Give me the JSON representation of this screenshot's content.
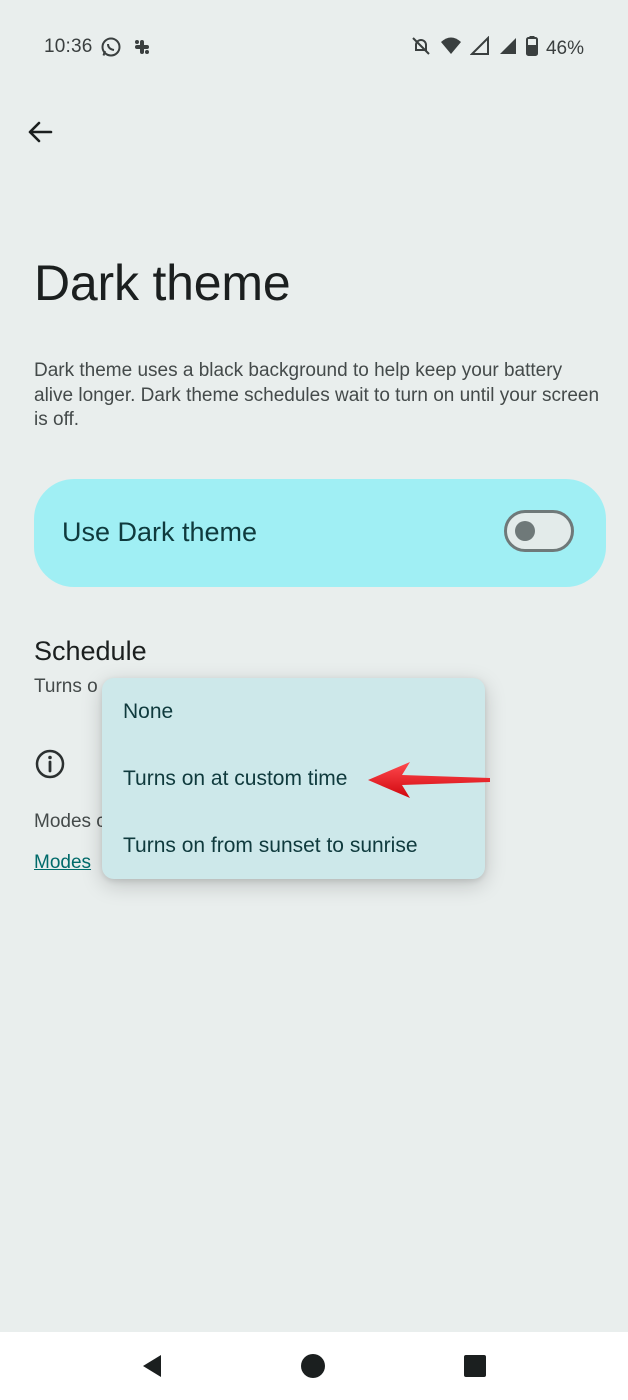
{
  "status_bar": {
    "time": "10:36",
    "left_icons": [
      "whatsapp-icon",
      "slack-icon"
    ],
    "right_icons": [
      "mute-icon",
      "wifi-icon",
      "signal-icon",
      "signal-icon",
      "battery-icon"
    ],
    "battery": "46%"
  },
  "page": {
    "title": "Dark theme",
    "description": "Dark theme uses a black background to help keep your battery alive longer. Dark theme schedules wait to turn on until your screen is off."
  },
  "dark_theme_card": {
    "label": "Use Dark theme",
    "toggle_on": false,
    "color": "#a0eff4"
  },
  "schedule": {
    "title": "Schedule",
    "subtitle": "Turns o",
    "modes_text": "Modes c",
    "modes_link": "Modes"
  },
  "schedule_menu": {
    "options": [
      "None",
      "Turns on at custom time",
      "Turns on from sunset to sunrise"
    ],
    "highlighted_option": "Turns on at custom time"
  },
  "annotation": {
    "arrow_color": "#e8141b"
  },
  "nav_bar": {
    "buttons": [
      "back-icon",
      "home-icon",
      "recents-icon"
    ]
  }
}
